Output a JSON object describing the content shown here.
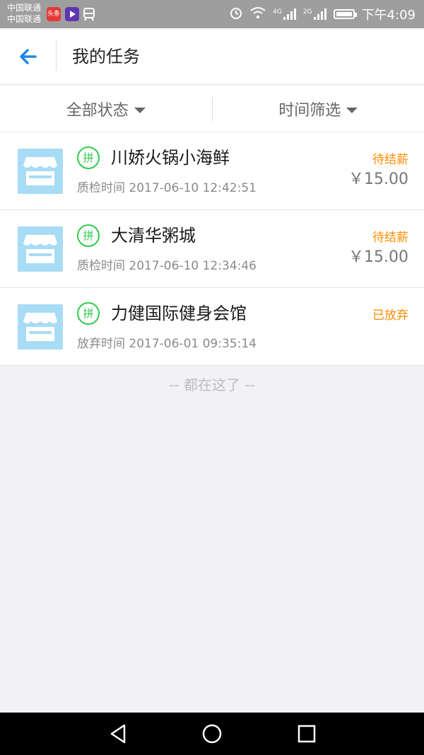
{
  "status_bar": {
    "carrier_1": "中国联通",
    "carrier_2": "中国联通",
    "toutiao_label": "头条",
    "network_4g": "4G",
    "network_2g": "2G",
    "time": "下午4:09"
  },
  "header": {
    "title": "我的任务"
  },
  "filters": {
    "status_filter": "全部状态",
    "time_filter": "时间筛选"
  },
  "tasks": [
    {
      "badge": "拼",
      "name": "川娇火锅小海鲜",
      "time_line": "质检时间 2017-06-10 12:42:51",
      "status": "待结薪",
      "price": "￥15.00"
    },
    {
      "badge": "拼",
      "name": "大清华粥城",
      "time_line": "质检时间 2017-06-10 12:34:46",
      "status": "待结薪",
      "price": "￥15.00"
    },
    {
      "badge": "拼",
      "name": "力健国际健身会馆",
      "time_line": "放弃时间 2017-06-01 09:35:14",
      "status": "已放弃",
      "price": ""
    }
  ],
  "end_text": "-- 都在这了 --",
  "colors": {
    "accent": "#1e88e5",
    "status_orange": "#ff8c00",
    "badge_green": "#2ecc4c",
    "shop_icon_bg": "#a8dcf5"
  }
}
